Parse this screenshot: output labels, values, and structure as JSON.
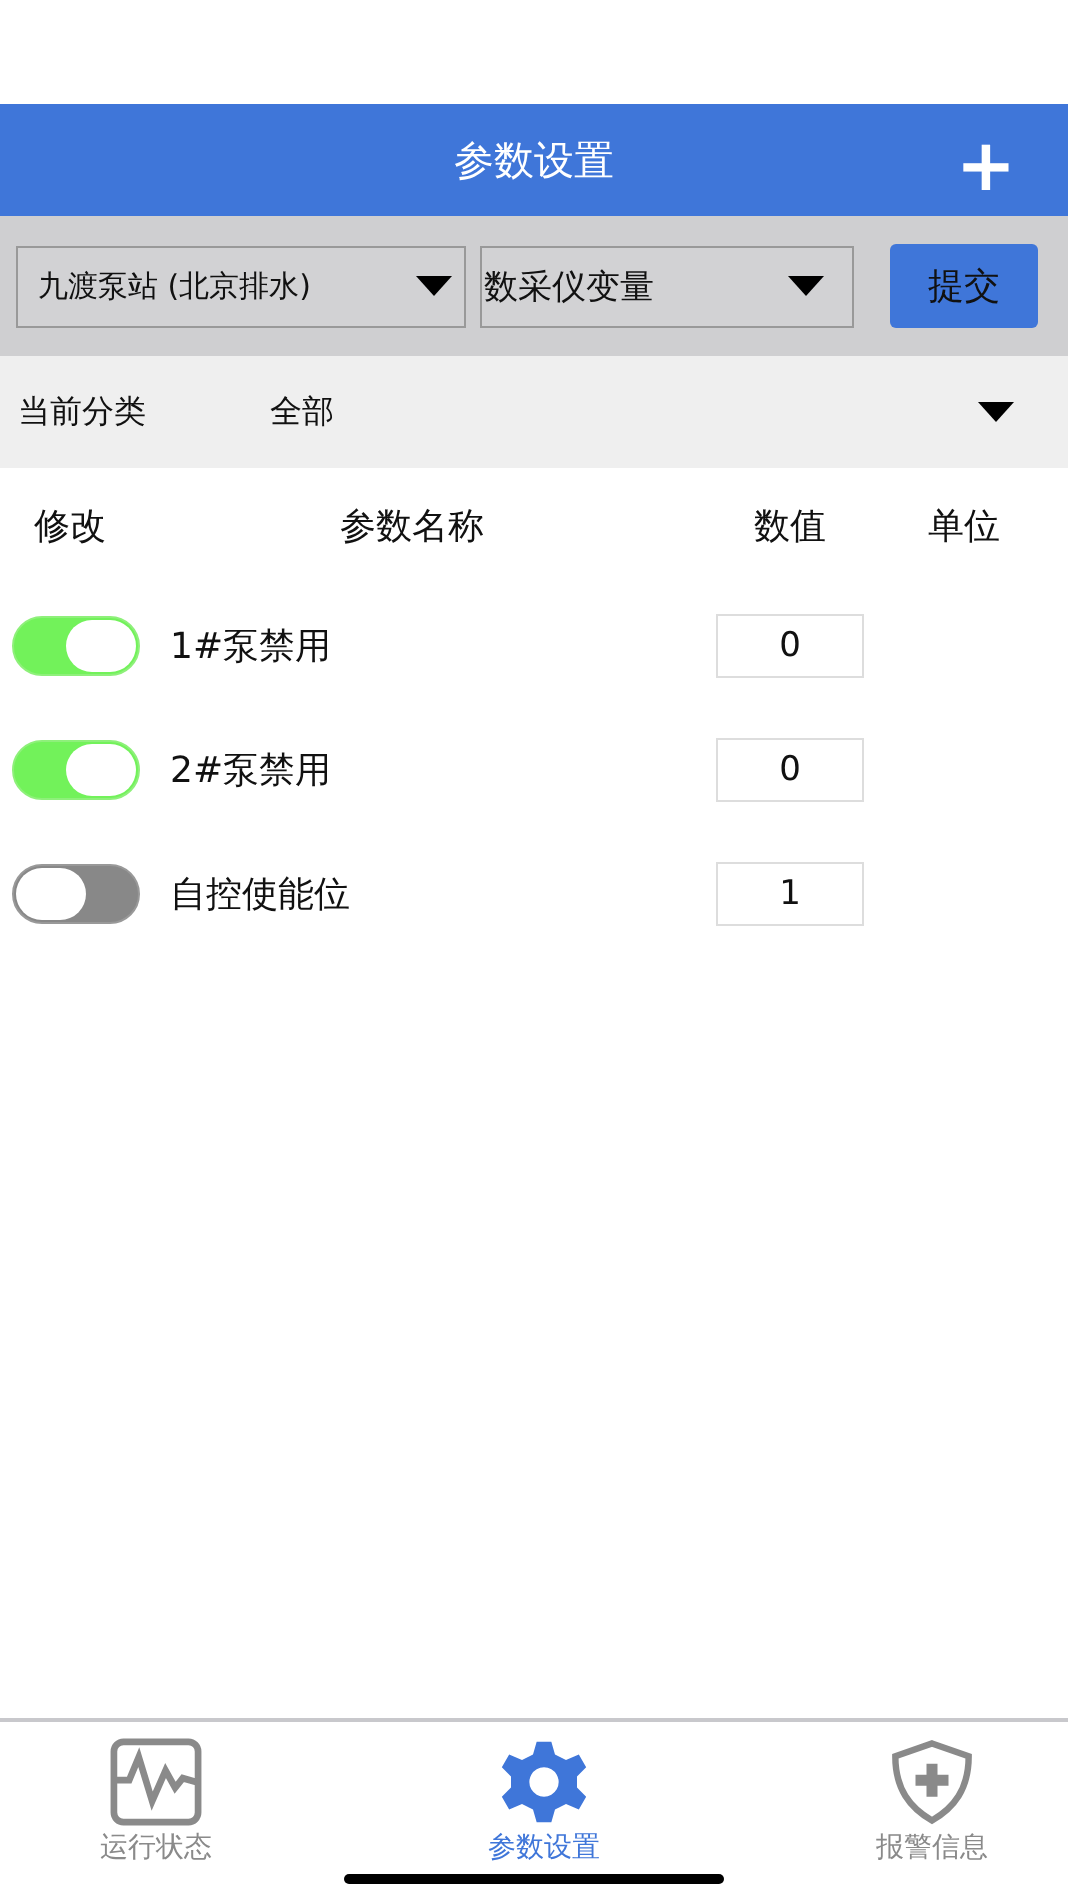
{
  "header": {
    "title": "参数设置",
    "add_label": "+"
  },
  "toolbar": {
    "station": "九渡泵站 (北京排水)",
    "variable": "数采仪变量",
    "submit": "提交"
  },
  "filter": {
    "label": "当前分类",
    "value": "全部"
  },
  "table": {
    "columns": [
      "修改",
      "参数名称",
      "数值",
      "单位"
    ],
    "rows": [
      {
        "on": true,
        "name": "1#泵禁用",
        "value": "0"
      },
      {
        "on": true,
        "name": "2#泵禁用",
        "value": "0"
      },
      {
        "on": false,
        "name": "自控使能位",
        "value": "1"
      }
    ]
  },
  "tab_bar": [
    {
      "kind": "monitor",
      "label": "运行状态",
      "selected": false
    },
    {
      "kind": "gear",
      "label": "参数设置",
      "selected": true
    },
    {
      "kind": "shield",
      "label": "报警信息",
      "selected": false
    }
  ]
}
